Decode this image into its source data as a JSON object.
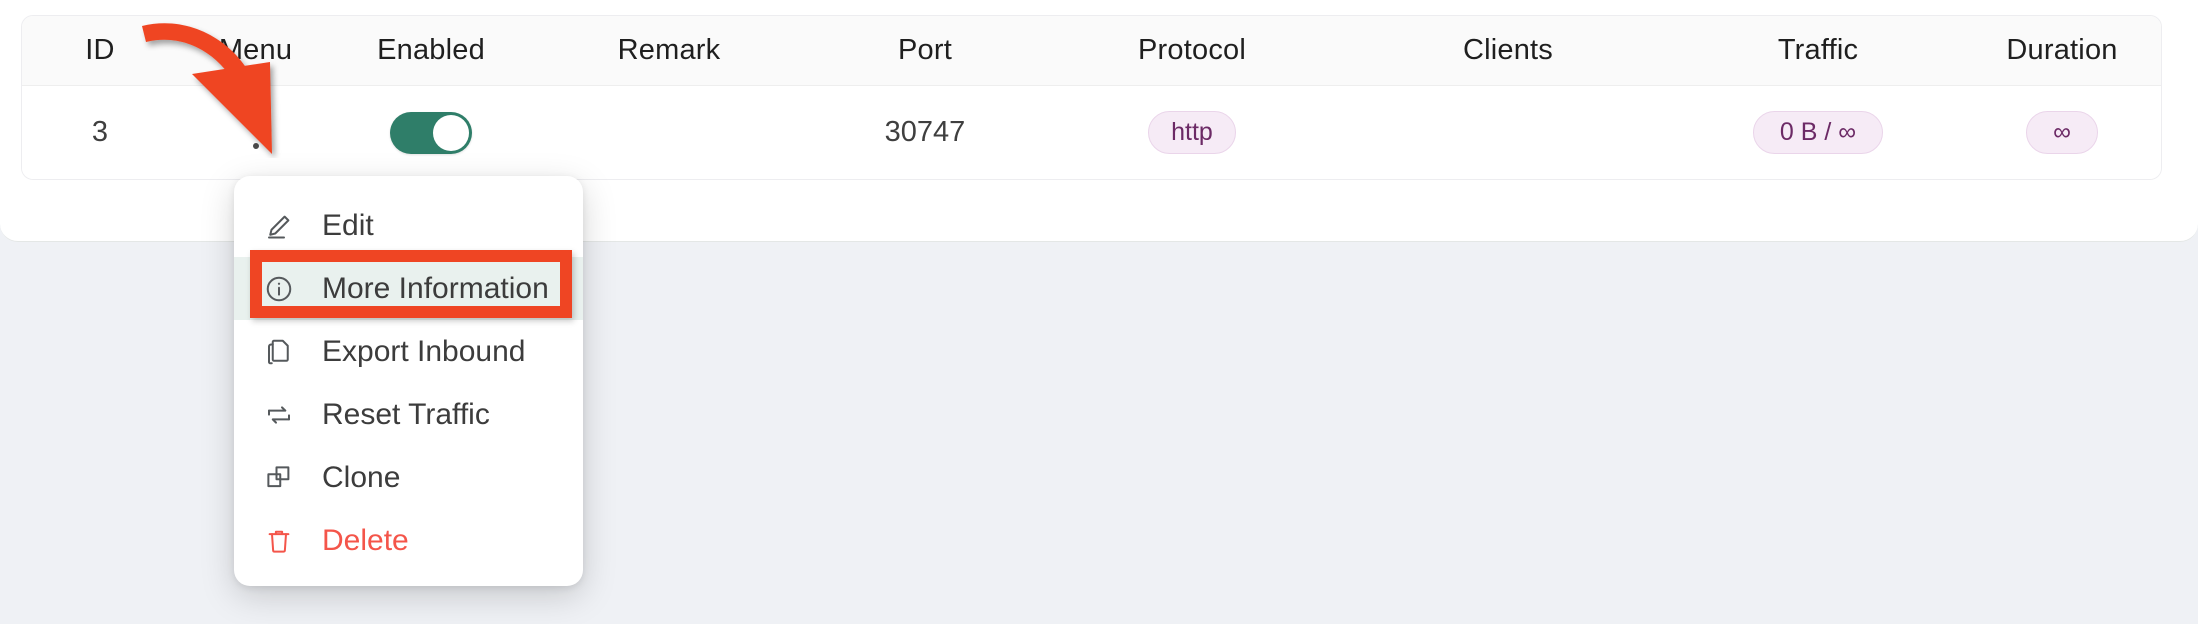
{
  "table": {
    "columns": [
      {
        "key": "id",
        "label": "ID"
      },
      {
        "key": "menu",
        "label": "Menu"
      },
      {
        "key": "enabled",
        "label": "Enabled"
      },
      {
        "key": "remark",
        "label": "Remark"
      },
      {
        "key": "port",
        "label": "Port"
      },
      {
        "key": "protocol",
        "label": "Protocol"
      },
      {
        "key": "clients",
        "label": "Clients"
      },
      {
        "key": "traffic",
        "label": "Traffic"
      },
      {
        "key": "duration",
        "label": "Duration"
      }
    ],
    "rows": [
      {
        "id": "3",
        "menu_icon": "kebab-vertical-icon",
        "enabled": true,
        "remark": "",
        "port": "30747",
        "protocol": "http",
        "clients": "",
        "traffic": "0 B / ∞",
        "duration": "∞"
      }
    ]
  },
  "context_menu": {
    "items": [
      {
        "label": "Edit",
        "icon": "pencil-icon",
        "danger": false,
        "highlighted": false
      },
      {
        "label": "More Information",
        "icon": "info-icon",
        "danger": false,
        "highlighted": true
      },
      {
        "label": "Export Inbound",
        "icon": "copy-file-icon",
        "danger": false,
        "highlighted": false
      },
      {
        "label": "Reset Traffic",
        "icon": "refresh-icon",
        "danger": false,
        "highlighted": false
      },
      {
        "label": "Clone",
        "icon": "clone-icon",
        "danger": false,
        "highlighted": false
      },
      {
        "label": "Delete",
        "icon": "trash-icon",
        "danger": true,
        "highlighted": false
      }
    ]
  },
  "annotations": {
    "arrow": "red-curved-arrow-pointing-to-menu",
    "highlight_target": "More Information"
  },
  "colors": {
    "toggle_on": "#2f7e69",
    "pill_bg": "#f6ebf6",
    "pill_text": "#6c2a66",
    "danger": "#f4554a",
    "annotation_red": "#ef4523",
    "highlight_bg": "#e9f1ee",
    "page_bg": "#eff1f5",
    "header_bg": "#fafafa"
  }
}
